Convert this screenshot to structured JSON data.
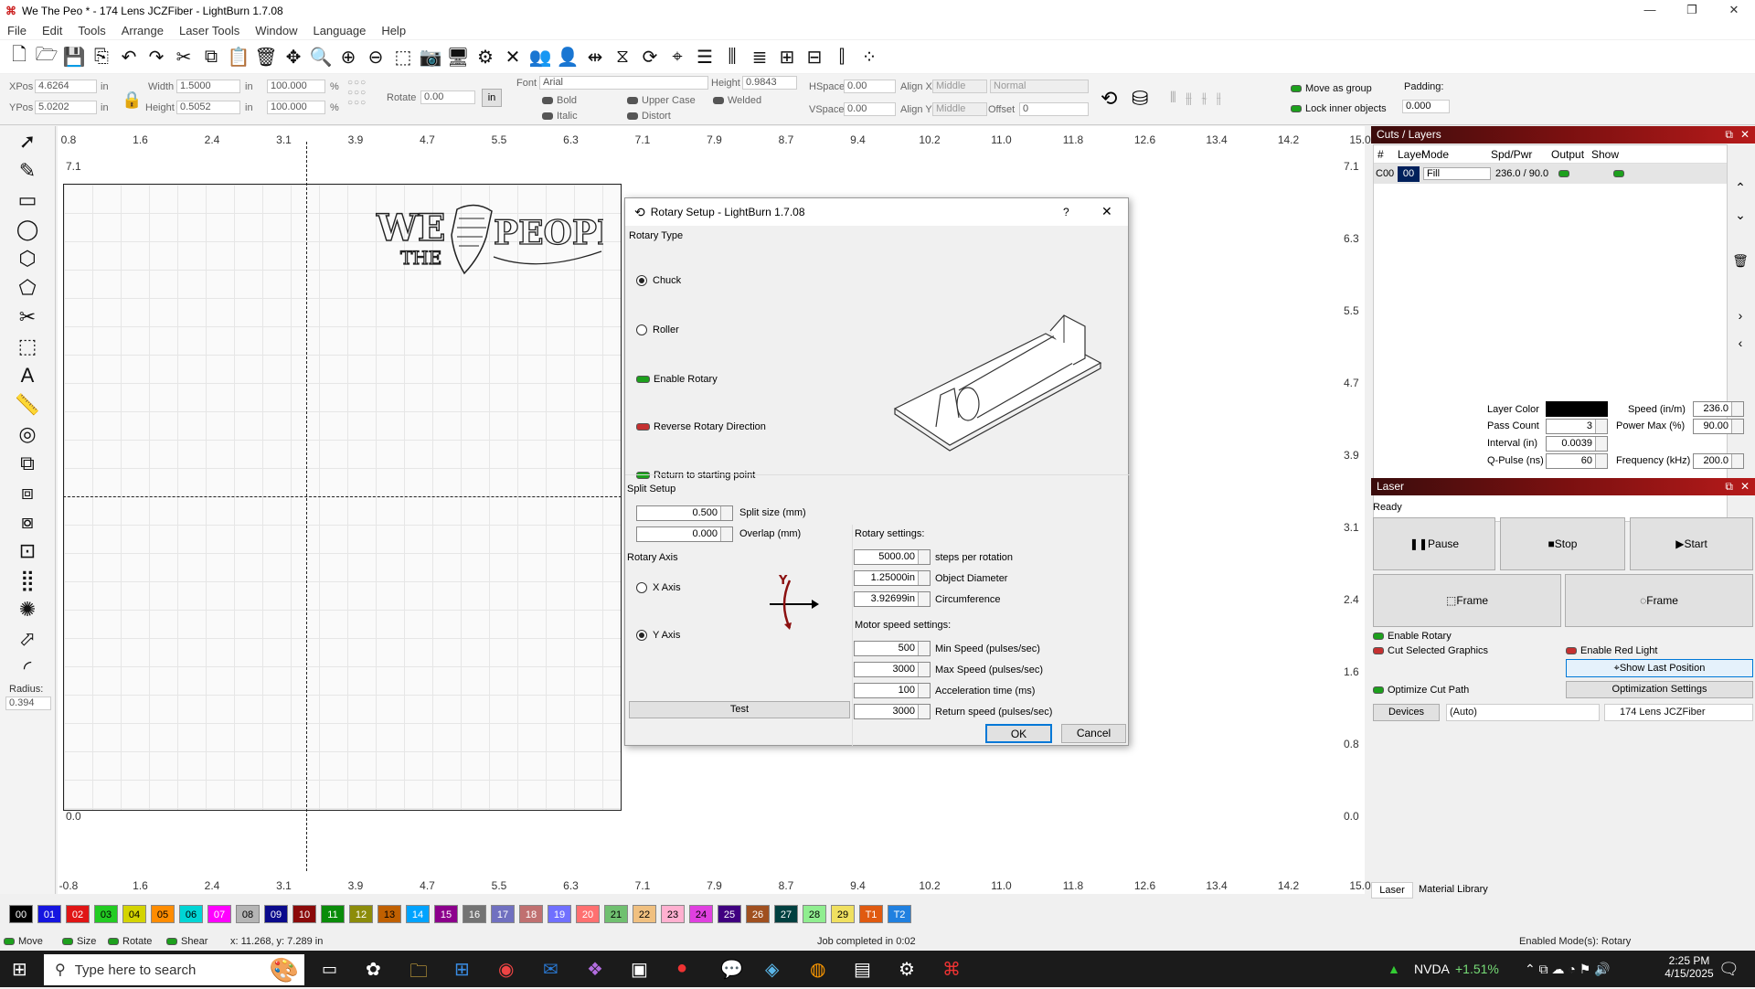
{
  "window": {
    "title": "We The Peo * - 174 Lens JCZFiber - LightBurn 1.7.08"
  },
  "menu": [
    "File",
    "Edit",
    "Tools",
    "Arrange",
    "Laser Tools",
    "Window",
    "Language",
    "Help"
  ],
  "props": {
    "xpos_label": "XPos",
    "xpos": "4.6264",
    "ypos_label": "YPos",
    "ypos": "5.0202",
    "unit": "in",
    "width_label": "Width",
    "width": "1.5000",
    "height_label": "Height",
    "height": "0.5052",
    "pct_w": "100.000",
    "pct_h": "100.000",
    "pct": "%",
    "rotate_label": "Rotate",
    "rotate": "0.00",
    "in_btn": "in",
    "font_label": "Font",
    "font": "Arial",
    "fheight_label": "Height",
    "fheight": "0.9843",
    "hspace_label": "HSpace",
    "hspace": "0.00",
    "vspace_label": "VSpace",
    "vspace": "0.00",
    "alignx_label": "Align X",
    "alignx": "Middle",
    "aligny_label": "Align Y",
    "aligny": "Middle",
    "normal": "Normal",
    "offset_label": "Offset",
    "offset": "0",
    "bold": "Bold",
    "italic": "Italic",
    "upper": "Upper Case",
    "distort": "Distort",
    "welded": "Welded",
    "move_group": "Move as group",
    "lock_inner": "Lock inner objects",
    "padding_label": "Padding:",
    "padding": "0.000"
  },
  "left_tools": {
    "radius_label": "Radius:",
    "radius": "0.394"
  },
  "ruler": {
    "top": [
      "0.8",
      "1.6",
      "2.4",
      "3.1",
      "3.9",
      "4.7",
      "5.5",
      "6.3",
      "7.1",
      "7.9",
      "8.7",
      "9.4",
      "10.2",
      "11.0",
      "11.8",
      "12.6",
      "13.4",
      "14.2",
      "15.0"
    ],
    "bottom": [
      "-0.8",
      "1.6",
      "2.4",
      "3.1",
      "3.9",
      "4.7",
      "5.5",
      "6.3",
      "7.1",
      "7.9",
      "8.7",
      "9.4",
      "10.2",
      "11.0",
      "11.8",
      "12.6",
      "13.4",
      "14.2",
      "15.0"
    ],
    "left": [
      "7.1",
      "6.3",
      "5.5",
      "4.7",
      "3.9",
      "3.1",
      "2.4",
      "1.6",
      "0.8",
      "0.0"
    ]
  },
  "dialog": {
    "title": "Rotary Setup - LightBurn 1.7.08",
    "help": "?",
    "close": "✕",
    "rotary_type": "Rotary Type",
    "chuck": "Chuck",
    "roller": "Roller",
    "enable_rotary": "Enable Rotary",
    "reverse": "Reverse Rotary Direction",
    "return_start": "Return to starting point",
    "split_setup": "Split Setup",
    "split_size": "0.500",
    "split_size_label": "Split size (mm)",
    "overlap": "0.000",
    "overlap_label": "Overlap (mm)",
    "rotary_axis": "Rotary Axis",
    "x_axis": "X Axis",
    "y_axis": "Y Axis",
    "test": "Test",
    "axis_y_glyph": "Y",
    "rotary_settings": "Rotary settings:",
    "steps": "5000.00",
    "steps_label": "steps per rotation",
    "diameter": "1.25000in",
    "diameter_label": "Object Diameter",
    "circ": "3.92699in",
    "circ_label": "Circumference",
    "motor_settings": "Motor speed settings:",
    "min_speed": "500",
    "min_speed_label": "Min Speed (pulses/sec)",
    "max_speed": "3000",
    "max_speed_label": "Max Speed (pulses/sec)",
    "accel": "100",
    "accel_label": "Acceleration time (ms)",
    "ret_speed": "3000",
    "ret_speed_label": "Return speed (pulses/sec)",
    "ok": "OK",
    "cancel": "Cancel"
  },
  "cuts": {
    "title": "Cuts / Layers",
    "cols": [
      "#",
      "Layer",
      "Mode",
      "Spd/Pwr",
      "Output",
      "Show"
    ],
    "row": {
      "num": "C00",
      "layer": "00",
      "mode": "Fill",
      "spd": "236.0 / 90.0"
    },
    "layer_color": "Layer Color",
    "speed_label": "Speed (in/m)",
    "speed": "236.0",
    "pass_label": "Pass Count",
    "pass": "3",
    "power_label": "Power Max (%)",
    "power": "90.00",
    "interval_label": "Interval (in)",
    "interval": "0.0039",
    "qpulse_label": "Q-Pulse (ns)",
    "qpulse": "60",
    "freq_label": "Frequency (kHz)",
    "freq": "200.0"
  },
  "laser": {
    "title": "Laser",
    "status": "Ready",
    "pause": "Pause",
    "stop": "Stop",
    "start": "Start",
    "frame1": "Frame",
    "frame2": "Frame",
    "enable_rotary": "Enable Rotary",
    "cut_selected": "Cut Selected Graphics",
    "red_light": "Enable Red Light",
    "show_last": "Show Last Position",
    "optimize": "Optimize Cut Path",
    "opt_settings": "Optimization Settings",
    "devices": "Devices",
    "auto": "(Auto)",
    "device": "174 Lens JCZFiber",
    "tab_laser": "Laser",
    "tab_material": "Material Library"
  },
  "palette": [
    {
      "n": "00",
      "c": "#000000",
      "t": "#ffffff"
    },
    {
      "n": "01",
      "c": "#1515e0",
      "t": "#ffffff"
    },
    {
      "n": "02",
      "c": "#e01515",
      "t": "#ffffff"
    },
    {
      "n": "03",
      "c": "#22cc22",
      "t": "#000"
    },
    {
      "n": "04",
      "c": "#d4d400",
      "t": "#000"
    },
    {
      "n": "05",
      "c": "#ff8c00",
      "t": "#000"
    },
    {
      "n": "06",
      "c": "#00d5d5",
      "t": "#000"
    },
    {
      "n": "07",
      "c": "#ff00ff",
      "t": "#fff"
    },
    {
      "n": "08",
      "c": "#b5b5b5",
      "t": "#000"
    },
    {
      "n": "09",
      "c": "#0a0a8c",
      "t": "#fff"
    },
    {
      "n": "10",
      "c": "#8b0a0a",
      "t": "#fff"
    },
    {
      "n": "11",
      "c": "#0a8c0a",
      "t": "#fff"
    },
    {
      "n": "12",
      "c": "#8c8c0a",
      "t": "#fff"
    },
    {
      "n": "13",
      "c": "#c06000",
      "t": "#000"
    },
    {
      "n": "14",
      "c": "#00a3ff",
      "t": "#fff"
    },
    {
      "n": "15",
      "c": "#8c008c",
      "t": "#fff"
    },
    {
      "n": "16",
      "c": "#737373",
      "t": "#fff"
    },
    {
      "n": "17",
      "c": "#7070c0",
      "t": "#fff"
    },
    {
      "n": "18",
      "c": "#c07070",
      "t": "#fff"
    },
    {
      "n": "19",
      "c": "#7070ff",
      "t": "#fff"
    },
    {
      "n": "20",
      "c": "#ff7070",
      "t": "#fff"
    },
    {
      "n": "21",
      "c": "#70c070",
      "t": "#000"
    },
    {
      "n": "22",
      "c": "#f0c080",
      "t": "#000"
    },
    {
      "n": "23",
      "c": "#ffb0d0",
      "t": "#000"
    },
    {
      "n": "24",
      "c": "#e040e0",
      "t": "#000"
    },
    {
      "n": "25",
      "c": "#400080",
      "t": "#fff"
    },
    {
      "n": "26",
      "c": "#a05020",
      "t": "#fff"
    },
    {
      "n": "27",
      "c": "#004040",
      "t": "#fff"
    },
    {
      "n": "28",
      "c": "#90ee90",
      "t": "#000"
    },
    {
      "n": "29",
      "c": "#f0e060",
      "t": "#000"
    },
    {
      "n": "T1",
      "c": "#e05a10",
      "t": "#fff"
    },
    {
      "n": "T2",
      "c": "#2080e0",
      "t": "#fff"
    }
  ],
  "status": {
    "move": "Move",
    "size": "Size",
    "rotate": "Rotate",
    "shear": "Shear",
    "coords": "x: 11.268, y: 7.289 in",
    "job": "Job completed in 0:02",
    "mode": "Enabled Mode(s): Rotary"
  },
  "taskbar": {
    "search": "Type here to search",
    "stock": "NVDA",
    "stock_change": "+1.51%",
    "time": "2:25 PM",
    "date": "4/15/2025"
  }
}
